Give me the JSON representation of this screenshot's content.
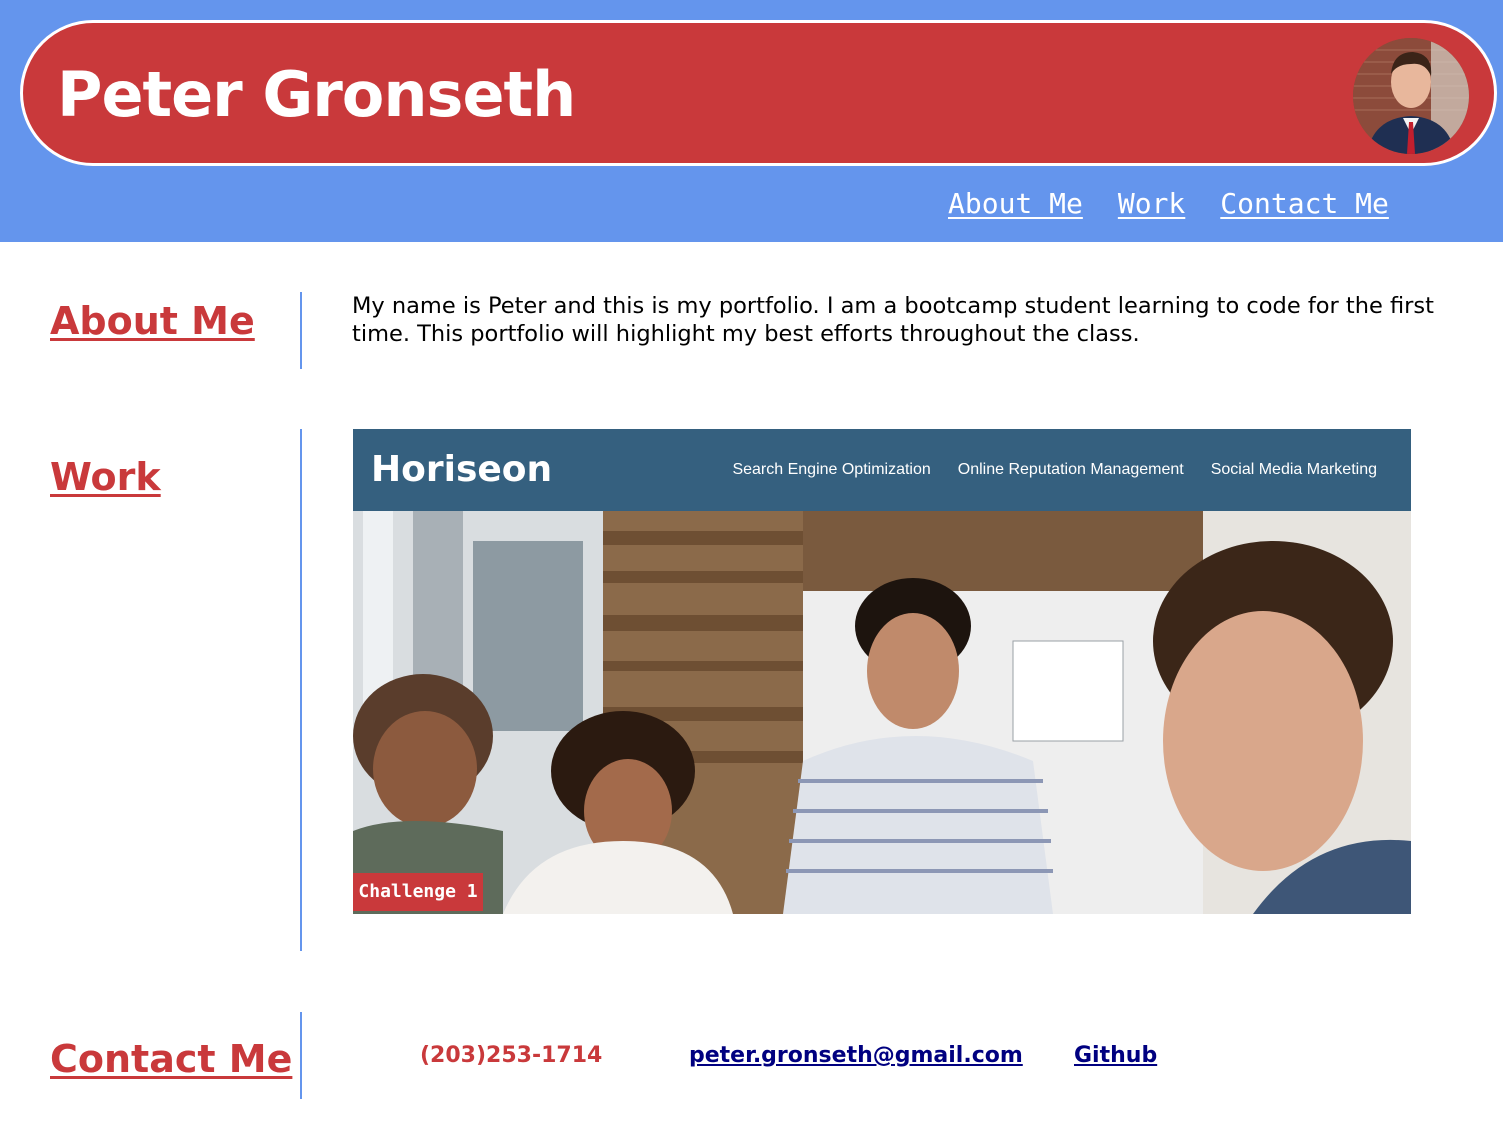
{
  "header": {
    "title": "Peter Gronseth",
    "avatar_icon": "portrait-photo",
    "nav": [
      "About Me",
      "Work",
      "Contact Me"
    ]
  },
  "about": {
    "heading": "About Me",
    "text": "My name is Peter and this is my portfolio. I am a bootcamp student learning to code for the first time. This portfolio will highlight my best efforts throughout the class."
  },
  "work": {
    "heading": "Work",
    "project": {
      "brand": "Horiseon",
      "links": [
        "Search Engine Optimization",
        "Online Reputation Management",
        "Social Media Marketing"
      ],
      "label": "Challenge 1"
    }
  },
  "contact": {
    "heading": "Contact Me",
    "phone": "(203)253-1714",
    "email": "peter.gronseth@gmail.com",
    "github": "Github"
  },
  "colors": {
    "header_bg": "#6495ed",
    "banner_red": "#c9393b",
    "heading_red": "#c9393b",
    "link_navy": "#000080",
    "project_header": "#35607f"
  }
}
